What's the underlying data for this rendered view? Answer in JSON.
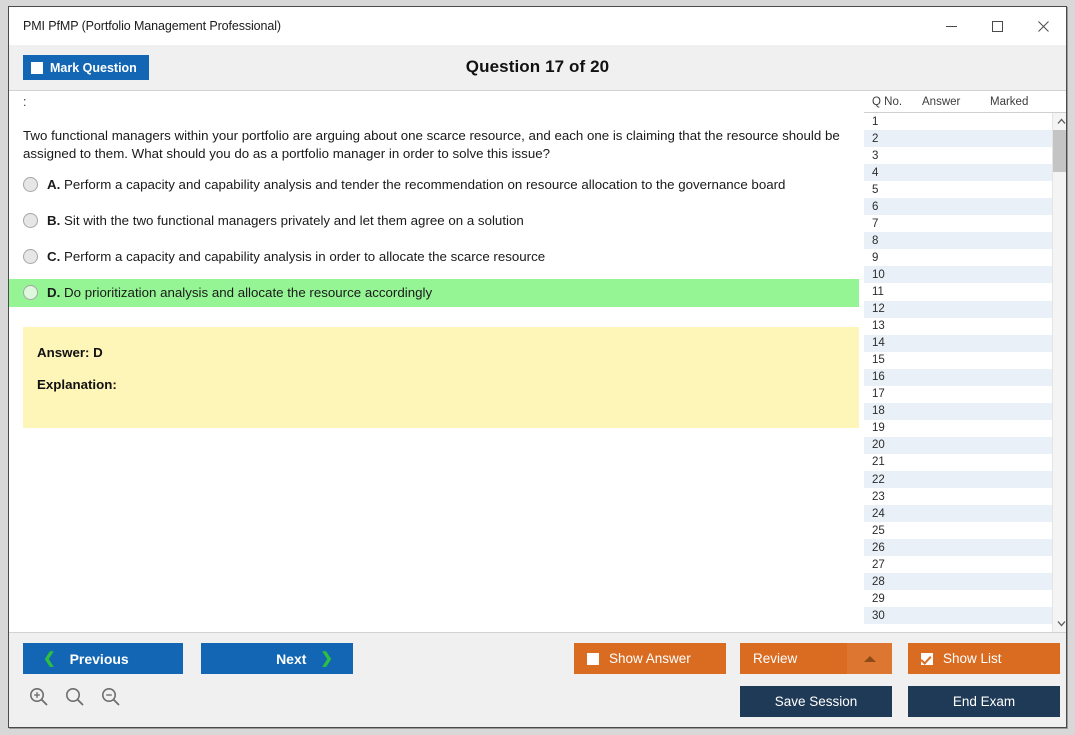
{
  "window": {
    "title": "PMI PfMP (Portfolio Management Professional)",
    "controls": [
      {
        "name": "minimize",
        "glyph": "minimize-icon"
      },
      {
        "name": "maximize",
        "glyph": "maximize-icon"
      },
      {
        "name": "close",
        "glyph": "close-icon"
      }
    ]
  },
  "header": {
    "mark_question_label": "Mark Question",
    "mark_question_checked": false,
    "question_heading": "Question 17 of 20"
  },
  "question": {
    "prefix": ":",
    "text": "Two functional managers within your portfolio are arguing about one scarce resource, and each one is claiming that the resource should be assigned to them. What should you do as a portfolio manager in order to solve this issue?",
    "options": [
      {
        "letter": "A.",
        "text": "Perform a capacity and capability analysis and tender the recommendation on resource allocation to the governance board",
        "correct": false,
        "selected": false
      },
      {
        "letter": "B.",
        "text": "Sit with the two functional managers privately and let them agree on a solution",
        "correct": false,
        "selected": false
      },
      {
        "letter": "C.",
        "text": "Perform a capacity and capability analysis in order to allocate the scarce resource",
        "correct": false,
        "selected": false
      },
      {
        "letter": "D.",
        "text": "Do prioritization analysis and allocate the resource accordingly",
        "correct": true,
        "selected": false
      }
    ]
  },
  "answer_panel": {
    "answer_line": "Answer: D",
    "explanation_line": "Explanation:"
  },
  "question_list": {
    "columns": [
      "Q No.",
      "Answer",
      "Marked"
    ],
    "rows": [
      {
        "qno": "1",
        "answer": "",
        "marked": ""
      },
      {
        "qno": "2",
        "answer": "",
        "marked": ""
      },
      {
        "qno": "3",
        "answer": "",
        "marked": ""
      },
      {
        "qno": "4",
        "answer": "",
        "marked": ""
      },
      {
        "qno": "5",
        "answer": "",
        "marked": ""
      },
      {
        "qno": "6",
        "answer": "",
        "marked": ""
      },
      {
        "qno": "7",
        "answer": "",
        "marked": ""
      },
      {
        "qno": "8",
        "answer": "",
        "marked": ""
      },
      {
        "qno": "9",
        "answer": "",
        "marked": ""
      },
      {
        "qno": "10",
        "answer": "",
        "marked": ""
      },
      {
        "qno": "11",
        "answer": "",
        "marked": ""
      },
      {
        "qno": "12",
        "answer": "",
        "marked": ""
      },
      {
        "qno": "13",
        "answer": "",
        "marked": ""
      },
      {
        "qno": "14",
        "answer": "",
        "marked": ""
      },
      {
        "qno": "15",
        "answer": "",
        "marked": ""
      },
      {
        "qno": "16",
        "answer": "",
        "marked": ""
      },
      {
        "qno": "17",
        "answer": "",
        "marked": ""
      },
      {
        "qno": "18",
        "answer": "",
        "marked": ""
      },
      {
        "qno": "19",
        "answer": "",
        "marked": ""
      },
      {
        "qno": "20",
        "answer": "",
        "marked": ""
      },
      {
        "qno": "21",
        "answer": "",
        "marked": ""
      },
      {
        "qno": "22",
        "answer": "",
        "marked": ""
      },
      {
        "qno": "23",
        "answer": "",
        "marked": ""
      },
      {
        "qno": "24",
        "answer": "",
        "marked": ""
      },
      {
        "qno": "25",
        "answer": "",
        "marked": ""
      },
      {
        "qno": "26",
        "answer": "",
        "marked": ""
      },
      {
        "qno": "27",
        "answer": "",
        "marked": ""
      },
      {
        "qno": "28",
        "answer": "",
        "marked": ""
      },
      {
        "qno": "29",
        "answer": "",
        "marked": ""
      },
      {
        "qno": "30",
        "answer": "",
        "marked": ""
      }
    ],
    "scroll_up_glyph": "chevron-up-icon",
    "scroll_down_glyph": "chevron-down-icon"
  },
  "footer": {
    "previous_label": "Previous",
    "next_label": "Next",
    "show_answer_label": "Show Answer",
    "show_answer_checked": false,
    "review_label": "Review",
    "show_list_label": "Show List",
    "show_list_checked": true,
    "save_session_label": "Save Session",
    "end_exam_label": "End Exam",
    "zoom_tools": [
      {
        "name": "zoom-in-icon"
      },
      {
        "name": "zoom-reset-icon"
      },
      {
        "name": "zoom-out-icon"
      }
    ]
  },
  "colors": {
    "primary_blue": "#1266b3",
    "orange": "#da6c22",
    "navy": "#1f3a56",
    "correct_green": "#95f595",
    "answer_yellow": "#fdf6b8",
    "chevron_green": "#2fbf3f",
    "row_alt": "#eaf0f7"
  }
}
